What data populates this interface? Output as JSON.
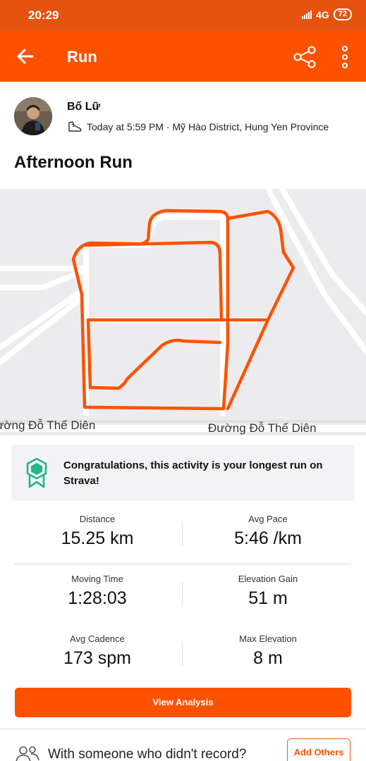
{
  "status_bar": {
    "time": "20:29",
    "network": "4G",
    "battery": "72"
  },
  "app_bar": {
    "title": "Run"
  },
  "activity": {
    "athlete_name": "Bố Lữ",
    "meta": "Today at 5:59 PM · Mỹ Hào District, Hung Yen Province",
    "title": "Afternoon Run"
  },
  "map": {
    "street_left": "ường Đỗ Thế Diên",
    "street_right": "Đường Đỗ Thế Diên",
    "route_color": "#fc5200"
  },
  "achievement": {
    "text": "Congratulations, this activity is your longest run on Strava!"
  },
  "stats": [
    {
      "label": "Distance",
      "value": "15.25 km"
    },
    {
      "label": "Avg Pace",
      "value": "5:46 /km"
    },
    {
      "label": "Moving Time",
      "value": "1:28:03"
    },
    {
      "label": "Elevation Gain",
      "value": "51 m"
    },
    {
      "label": "Avg Cadence",
      "value": "173 spm"
    },
    {
      "label": "Max Elevation",
      "value": "8 m"
    }
  ],
  "actions": {
    "view_analysis": "View Analysis",
    "record_question": "With someone who didn't record?",
    "add_others": "Add Others"
  },
  "colors": {
    "brand": "#fc5200",
    "status_bar": "#e5530f"
  }
}
